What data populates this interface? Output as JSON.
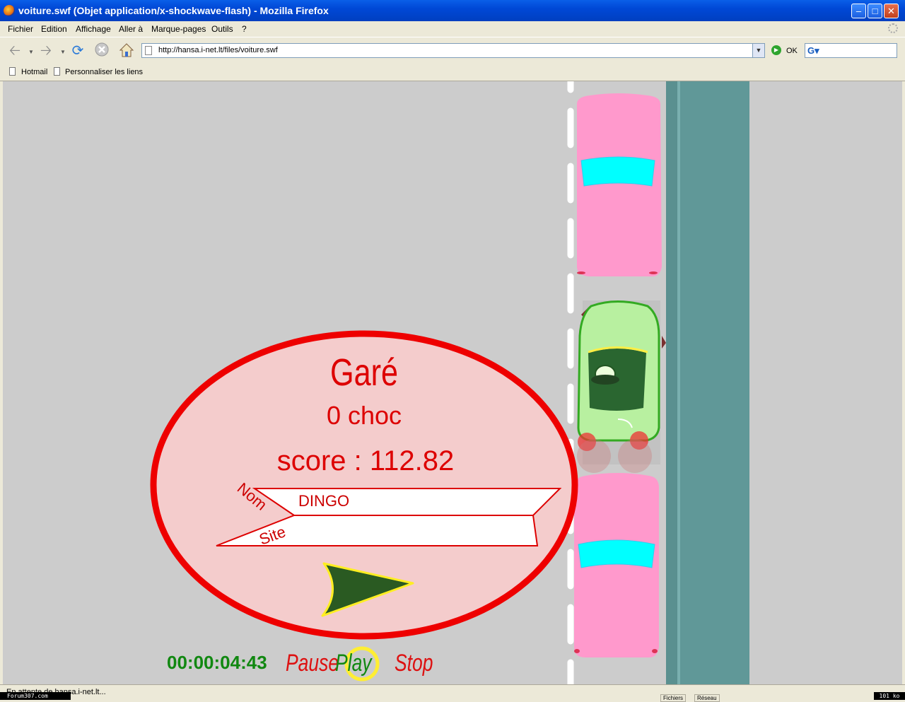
{
  "window": {
    "title": "voiture.swf (Objet application/x-shockwave-flash) - Mozilla Firefox"
  },
  "menu": {
    "items": [
      "Fichier",
      "Edition",
      "Affichage",
      "Aller à",
      "Marque-pages",
      "Outils",
      "?"
    ]
  },
  "navigation": {
    "url": "http://hansa.i-net.lt/files/voiture.swf",
    "go_label": "OK",
    "search_placeholder": ""
  },
  "bookmarks": {
    "items": [
      "Hotmail",
      "Personnaliser les liens"
    ]
  },
  "game": {
    "result_title": "Garé",
    "collisions": "0 choc",
    "score": "score : 112.82",
    "name_label": "Nom",
    "site_label": "Site",
    "name_value": "DINGO",
    "site_value": "",
    "timer": "00:00:04:43",
    "controls": {
      "pause": "Pause",
      "play": "Play",
      "stop": "Stop"
    },
    "colors": {
      "road": "#cccccc",
      "ellipse_fill": "#f4cccc",
      "ellipse_stroke": "#ee0000",
      "text_red": "#dd0000",
      "timer_green": "#118811",
      "parked_car": "#ff99cc",
      "player_car": "#b8f0a0",
      "sidewalk": "#609898"
    }
  },
  "status": {
    "text": "En attente de hansa.i-net.lt...",
    "pane1": "Fichiers",
    "pane2": "Réseau"
  },
  "watermark": {
    "left": "Forum307.com",
    "right": "101 ko"
  }
}
